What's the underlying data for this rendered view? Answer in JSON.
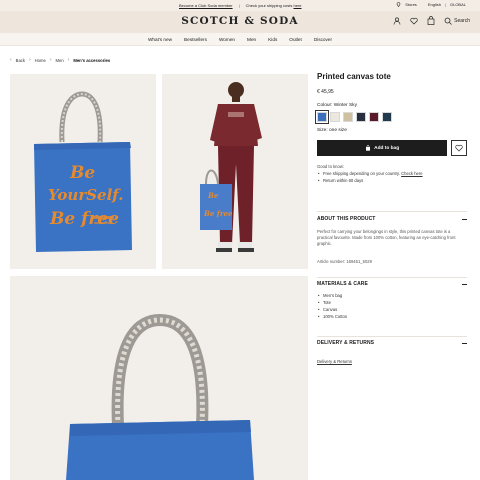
{
  "topbar": {
    "promo_left": "Become a Club Soda member",
    "separator": "|",
    "promo_right": "Check your shipping costs",
    "promo_right_link": "here",
    "stores": "Stores",
    "language": "English",
    "region": "GLOBAL"
  },
  "header": {
    "logo": "SCOTCH & SODA",
    "search_label": "Search",
    "icons": [
      "account-icon",
      "wishlist-icon",
      "bag-icon",
      "search-icon"
    ]
  },
  "nav": {
    "items": [
      "What's new",
      "Bestsellers",
      "Women",
      "Men",
      "Kids",
      "Outlet",
      "Discover"
    ]
  },
  "breadcrumb": {
    "items": [
      "Back",
      "Home",
      "Men",
      "Men's accessories"
    ]
  },
  "product": {
    "title": "Printed canvas tote",
    "price": "€ 45,95",
    "colour_label": "Colour: Winter Sky",
    "swatches": [
      "#3b6fbe",
      "#ece7df",
      "#cfc0a0",
      "#283040",
      "#5a1a2a",
      "#223a4e"
    ],
    "size_label": "Size: one size",
    "add_to_bag": "Add to bag",
    "good_to_know": "Good to know:",
    "benefits": [
      "Free shipping depending on your country.",
      "Return within 60 days"
    ],
    "benefit_link": "Check here"
  },
  "about": {
    "heading": "ABOUT THIS PRODUCT",
    "text": "Perfect for carrying your belongings in style, this printed canvas tote is a practical favourite. Made from 100% cotton, featuring an eye-catching front graphic.",
    "article": "Article number: 169451_5029"
  },
  "materials": {
    "heading": "MATERIALS & CARE",
    "items": [
      "Men's bag",
      "Tote",
      "Canvas",
      "100% Cotton"
    ]
  },
  "delivery": {
    "heading": "DELIVERY & RETURNS",
    "link": "Delivery & Returns"
  },
  "artwork": {
    "line1": "Be",
    "line2": "YourSelf.",
    "line3": "Be free"
  },
  "colors": {
    "tote_blue": "#3a72c4",
    "print_orange": "#e68a2e",
    "header_bg": "#eee6dc",
    "button_dark": "#1d1d1d"
  }
}
